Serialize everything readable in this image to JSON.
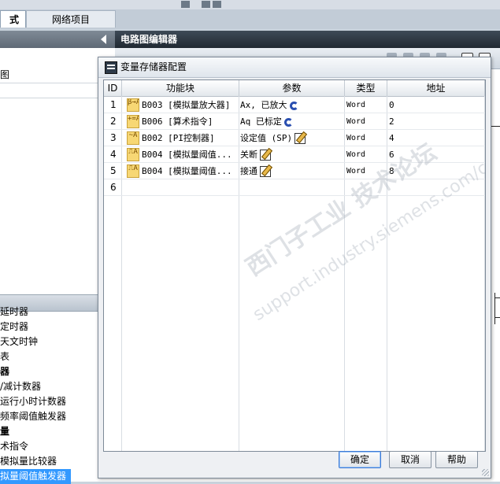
{
  "app": {
    "left_tab_active": "式",
    "left_tab_network": "网络项目",
    "editor_title": "电路图编辑器",
    "left_tree_top": [
      "图"
    ],
    "left_tree_items": [
      {
        "label": "延时器",
        "selected": false
      },
      {
        "label": "定时器",
        "selected": false
      },
      {
        "label": "天文时钟",
        "selected": false
      },
      {
        "label": "表",
        "selected": false
      },
      {
        "label": "器",
        "selected": false,
        "bold": true
      },
      {
        "label": "/减计数器",
        "selected": false
      },
      {
        "label": "运行小时计数器",
        "selected": false
      },
      {
        "label": "频率阈值触发器",
        "selected": false
      },
      {
        "label": "量",
        "selected": false,
        "bold": true
      },
      {
        "label": "术指令",
        "selected": false
      },
      {
        "label": "模拟量比较器",
        "selected": false
      },
      {
        "label": "拟量阈值触发器",
        "selected": true
      }
    ]
  },
  "dialog": {
    "title": "变量存储器配置",
    "columns": [
      "ID",
      "功能块",
      "参数",
      "类型",
      "地址"
    ],
    "rows": [
      {
        "id": "1",
        "icon": "amplifier-icon",
        "icon_text": "β→A",
        "block": "B003 [模拟量放大器]",
        "param": "Ax, 已放大",
        "param_icon": "refresh-icon",
        "type": "Word",
        "addr": "0"
      },
      {
        "id": "2",
        "icon": "math-icon",
        "icon_text": "+=A",
        "block": "B006 [算术指令]",
        "param": "Aq 已标定",
        "param_icon": "refresh-icon",
        "type": "Word",
        "addr": "2"
      },
      {
        "id": "3",
        "icon": "pi-controller-icon",
        "icon_text": "~A",
        "block": "B002 [PI控制器]",
        "param": "设定值 (SP)",
        "param_icon": "edit-icon",
        "type": "Word",
        "addr": "4"
      },
      {
        "id": "4",
        "icon": "threshold-icon",
        "icon_text": "⎍A",
        "block": "B004 [模拟量阈值...",
        "param": "关断",
        "param_icon": "edit-icon",
        "type": "Word",
        "addr": "6"
      },
      {
        "id": "5",
        "icon": "threshold-icon",
        "icon_text": "⎍A",
        "block": "B004 [模拟量阈值...",
        "param": "接通",
        "param_icon": "edit-icon",
        "type": "Word",
        "addr": "8"
      },
      {
        "id": "6",
        "icon": "",
        "icon_text": "",
        "block": "",
        "param": "",
        "param_icon": "",
        "type": "",
        "addr": ""
      }
    ],
    "buttons": {
      "ok": "确定",
      "cancel": "取消",
      "help": "帮助"
    },
    "watermark": "西门子工业  技术论坛",
    "watermark_url": "support.industry.siemens.com/cs"
  }
}
